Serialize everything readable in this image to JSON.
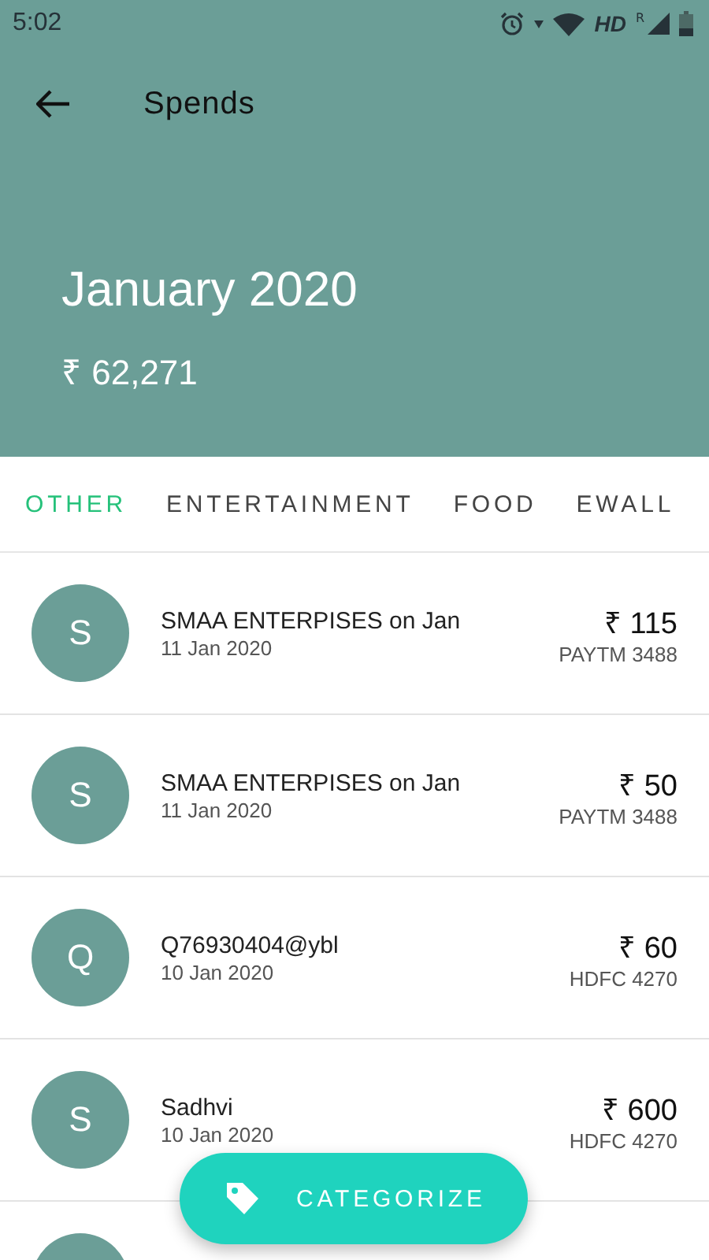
{
  "status_bar": {
    "time": "5:02",
    "network_type": "HD",
    "roaming": "R"
  },
  "header": {
    "title": "Spends",
    "month": "January 2020",
    "total": "₹ 62,271"
  },
  "tabs": [
    {
      "label": "OTHER",
      "selected": true
    },
    {
      "label": "ENTERTAINMENT",
      "selected": false
    },
    {
      "label": "FOOD",
      "selected": false
    },
    {
      "label": "EWALL",
      "selected": false
    }
  ],
  "transactions": [
    {
      "initial": "S",
      "name": "SMAA ENTERPISES on Jan",
      "date": "11 Jan 2020",
      "amount": "₹ 115",
      "account": "PAYTM 3488"
    },
    {
      "initial": "S",
      "name": "SMAA ENTERPISES on Jan",
      "date": "11 Jan 2020",
      "amount": "₹ 50",
      "account": "PAYTM 3488"
    },
    {
      "initial": "Q",
      "name": "Q76930404@ybl",
      "date": "10 Jan 2020",
      "amount": "₹ 60",
      "account": "HDFC 4270"
    },
    {
      "initial": "S",
      "name": "Sadhvi",
      "date": "10 Jan 2020",
      "amount": "₹ 600",
      "account": "HDFC 4270"
    }
  ],
  "fab": {
    "label": "CATEGORIZE"
  }
}
